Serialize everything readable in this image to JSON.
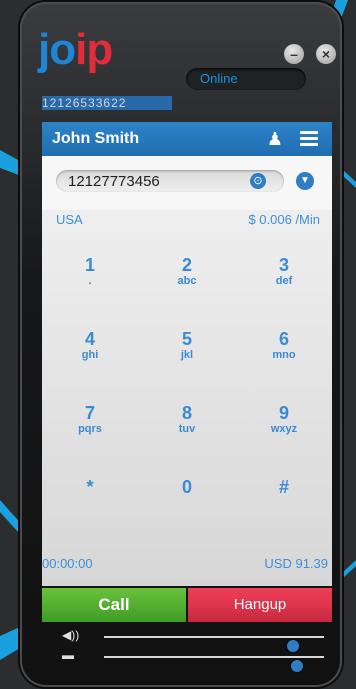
{
  "app": {
    "logo_part1": "jo",
    "logo_part2": "ip",
    "status": "Online",
    "account_number": "12126533622"
  },
  "window_controls": {
    "minimize_glyph": "–",
    "close_glyph": "×"
  },
  "header": {
    "contact_name": "John Smith",
    "contacts_icon": "contacts-icon",
    "menu_icon": "menu-icon"
  },
  "dialer": {
    "number_value": "12127773456",
    "clear_glyph": "⊙",
    "dropdown_glyph": "▼",
    "country": "USA",
    "rate": "$ 0.006 /Min",
    "keys": [
      {
        "digit": "1",
        "letters": "."
      },
      {
        "digit": "2",
        "letters": "abc"
      },
      {
        "digit": "3",
        "letters": "def"
      },
      {
        "digit": "4",
        "letters": "ghi"
      },
      {
        "digit": "5",
        "letters": "jkl"
      },
      {
        "digit": "6",
        "letters": "mno"
      },
      {
        "digit": "7",
        "letters": "pqrs"
      },
      {
        "digit": "8",
        "letters": "tuv"
      },
      {
        "digit": "9",
        "letters": "wxyz"
      },
      {
        "digit": "*",
        "letters": ""
      },
      {
        "digit": "0",
        "letters": ""
      },
      {
        "digit": "#",
        "letters": ""
      }
    ],
    "timer": "00:00:00",
    "balance": "USD 91.39"
  },
  "actions": {
    "call_label": "Call",
    "hangup_label": "Hangup"
  },
  "audio": {
    "speaker_icon": "speaker-volume-icon",
    "mic_icon": "microphone-volume-icon",
    "speaker_glyph": "◀))",
    "mic_glyph": "▬",
    "speaker_level": 0.88,
    "mic_level": 0.9
  },
  "colors": {
    "accent": "#1d84d6",
    "brand_red": "#e12c3c",
    "call_green": "#4aa92c",
    "hangup_red": "#e0344b",
    "callout_blue": "#1aa0de"
  }
}
